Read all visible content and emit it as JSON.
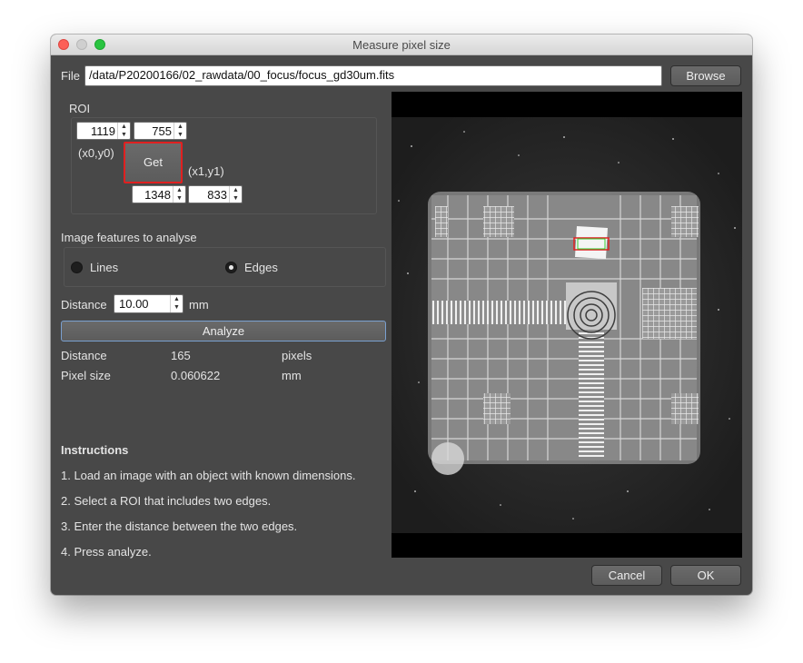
{
  "window": {
    "title": "Measure pixel size"
  },
  "file": {
    "label": "File",
    "path": "/data/P20200166/02_rawdata/00_focus/focus_gd30um.fits",
    "browse_label": "Browse"
  },
  "roi": {
    "label": "ROI",
    "x0": "1119",
    "y0": "755",
    "x1": "1348",
    "y1": "833",
    "x0y0_label": "(x0,y0)",
    "x1y1_label": "(x1,y1)",
    "get_label": "Get"
  },
  "features": {
    "label": "Image features to analyse",
    "options": [
      "Lines",
      "Edges"
    ],
    "selected": "Edges"
  },
  "distance_input": {
    "label": "Distance",
    "value": "10.00",
    "unit": "mm"
  },
  "analyze_label": "Analyze",
  "results": [
    {
      "name": "Distance",
      "value": "165",
      "unit": "pixels"
    },
    {
      "name": "Pixel size",
      "value": "0.060622",
      "unit": "mm"
    }
  ],
  "instructions": {
    "title": "Instructions",
    "steps": [
      "1. Load an image with an object with known dimensions.",
      "2. Select a ROI that includes two edges.",
      "3. Enter the distance between the two edges.",
      "4. Press analyze."
    ]
  },
  "footer": {
    "cancel_label": "Cancel",
    "ok_label": "OK"
  },
  "colors": {
    "roi_highlight": "#e02020",
    "accent_border": "#7aa0d0"
  }
}
